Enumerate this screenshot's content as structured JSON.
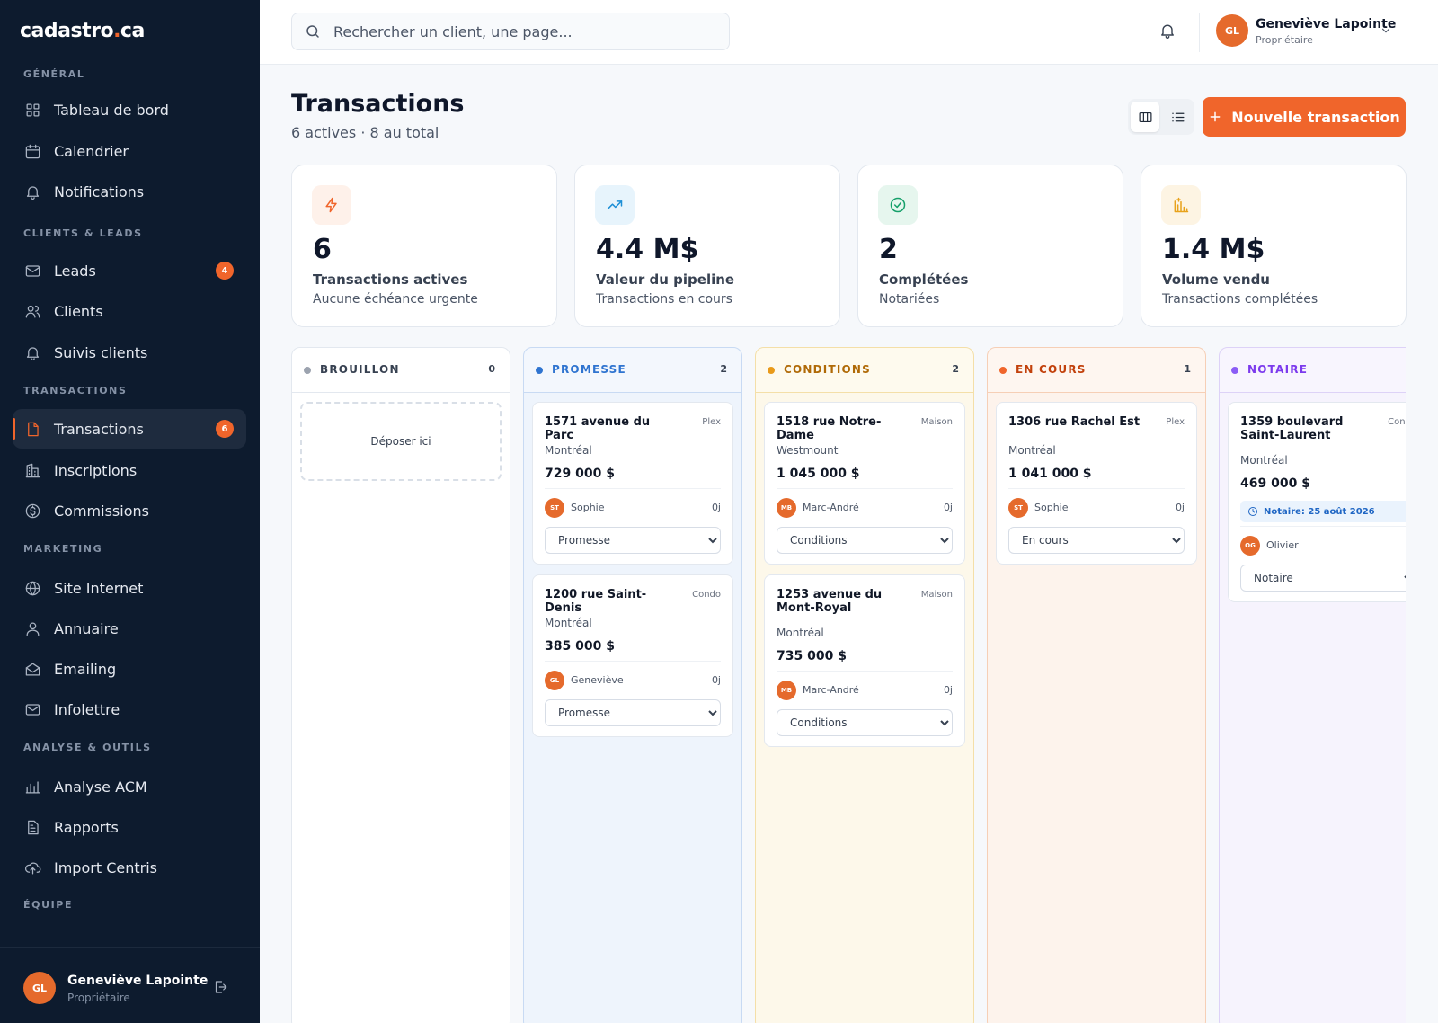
{
  "app": {
    "logo_main": "cadastro",
    "logo_dot": ".",
    "logo_tld": "ca"
  },
  "sidebar": {
    "sections": [
      {
        "label": "GÉNÉRAL"
      },
      {
        "label": "CLIENTS & LEADS"
      },
      {
        "label": "TRANSACTIONS"
      },
      {
        "label": "MARKETING"
      },
      {
        "label": "ANALYSE & OUTILS"
      },
      {
        "label": "ÉQUIPE"
      }
    ],
    "items": [
      {
        "label": "Tableau de bord",
        "icon": "grid-icon"
      },
      {
        "label": "Calendrier",
        "icon": "calendar-icon"
      },
      {
        "label": "Notifications",
        "icon": "bell-icon"
      },
      {
        "label": "Leads",
        "icon": "mail-icon",
        "badge": "4"
      },
      {
        "label": "Clients",
        "icon": "users-icon"
      },
      {
        "label": "Suivis clients",
        "icon": "bell-icon"
      },
      {
        "label": "Transactions",
        "icon": "file-icon",
        "badge": "6",
        "active": true
      },
      {
        "label": "Inscriptions",
        "icon": "building-icon"
      },
      {
        "label": "Commissions",
        "icon": "dollar-icon"
      },
      {
        "label": "Site Internet",
        "icon": "globe-icon"
      },
      {
        "label": "Annuaire",
        "icon": "user-icon"
      },
      {
        "label": "Emailing",
        "icon": "envelope-open-icon"
      },
      {
        "label": "Infolettre",
        "icon": "mail-icon"
      },
      {
        "label": "Analyse ACM",
        "icon": "bar-chart-icon"
      },
      {
        "label": "Rapports",
        "icon": "report-icon"
      },
      {
        "label": "Import Centris",
        "icon": "cloud-upload-icon"
      }
    ],
    "user": {
      "initials": "GL",
      "name": "Geneviève Lapointe",
      "role": "Propriétaire"
    }
  },
  "topbar": {
    "search_placeholder": "Rechercher un client, une page...",
    "user": {
      "initials": "GL",
      "name": "Geneviève Lapointe",
      "role": "Propriétaire"
    }
  },
  "page": {
    "title": "Transactions",
    "subtitle": "6 actives · 8 au total",
    "new_button": "Nouvelle transaction"
  },
  "stats": [
    {
      "value": "6",
      "label": "Transactions actives",
      "sub": "Aucune échéance urgente",
      "icon": "lightning-icon",
      "color": "#f0652b",
      "bg": "#fef1ea"
    },
    {
      "value": "4.4 M$",
      "label": "Valeur du pipeline",
      "sub": "Transactions en cours",
      "icon": "trending-up-icon",
      "color": "#1d8fd6",
      "bg": "#e7f4fc"
    },
    {
      "value": "2",
      "label": "Complétées",
      "sub": "Notariées",
      "icon": "check-circle-icon",
      "color": "#16a06a",
      "bg": "#e6f6ee"
    },
    {
      "value": "1.4 M$",
      "label": "Volume vendu",
      "sub": "Transactions complétées",
      "icon": "building-chart-icon",
      "color": "#e8a21b",
      "bg": "#fdf4e3"
    }
  ],
  "columns": [
    {
      "title": "BROUILLON",
      "count": "0",
      "color": "#9ca3af",
      "title_color": "#374151",
      "bg": "#ffffff",
      "head_bg": "#ffffff",
      "border": "#e3e8ef",
      "dropzone": "Déposer ici",
      "cards": []
    },
    {
      "title": "PROMESSE",
      "count": "2",
      "color": "#2f74d0",
      "title_color": "#2f74d0",
      "bg": "#eef4fc",
      "head_bg": "#f3f7fd",
      "border": "#c8daf3",
      "cards": [
        {
          "address": "1571 avenue du Parc",
          "type": "Plex",
          "city": "Montréal",
          "price": "729 000 $",
          "initials": "ST",
          "agent": "Sophie",
          "days": "0j",
          "status": "Promesse"
        },
        {
          "address": "1200 rue Saint-Denis",
          "type": "Condo",
          "city": "Montréal",
          "price": "385 000 $",
          "initials": "GL",
          "agent": "Geneviève",
          "days": "0j",
          "status": "Promesse"
        }
      ]
    },
    {
      "title": "CONDITIONS",
      "count": "2",
      "color": "#e99a1a",
      "title_color": "#b06a07",
      "bg": "#fdf8ea",
      "head_bg": "#fefaee",
      "border": "#f4dfa8",
      "cards": [
        {
          "address": "1518 rue Notre-Dame",
          "type": "Maison",
          "city": "Westmount",
          "price": "1 045 000 $",
          "initials": "MB",
          "agent": "Marc-André",
          "days": "0j",
          "status": "Conditions"
        },
        {
          "address": "1253 avenue du Mont-Royal",
          "type": "Maison",
          "city": "Montréal",
          "price": "735 000 $",
          "initials": "MB",
          "agent": "Marc-André",
          "days": "0j",
          "status": "Conditions"
        }
      ]
    },
    {
      "title": "EN COURS",
      "count": "1",
      "color": "#f0652b",
      "title_color": "#c2410c",
      "bg": "#fdf3ec",
      "head_bg": "#fef6f0",
      "border": "#f6cfb6",
      "cards": [
        {
          "address": "1306 rue Rachel Est",
          "type": "Plex",
          "city": "Montréal",
          "price": "1 041 000 $",
          "initials": "ST",
          "agent": "Sophie",
          "days": "0j",
          "status": "En cours"
        }
      ]
    },
    {
      "title": "NOTAIRE",
      "count": "",
      "color": "#8b5cf6",
      "title_color": "#7c3aed",
      "bg": "#f6f3fd",
      "head_bg": "#f8f5fe",
      "border": "#ddd2f7",
      "cards": [
        {
          "address": "1359 boulevard Saint-Laurent",
          "type": "Condo",
          "city": "Montréal",
          "price": "469 000 $",
          "notaire": "Notaire: 25 août 2026",
          "initials": "OG",
          "agent": "Olivier",
          "days": "",
          "status": "Notaire"
        }
      ]
    }
  ],
  "status_options": [
    "Brouillon",
    "Promesse",
    "Conditions",
    "En cours",
    "Notaire"
  ]
}
